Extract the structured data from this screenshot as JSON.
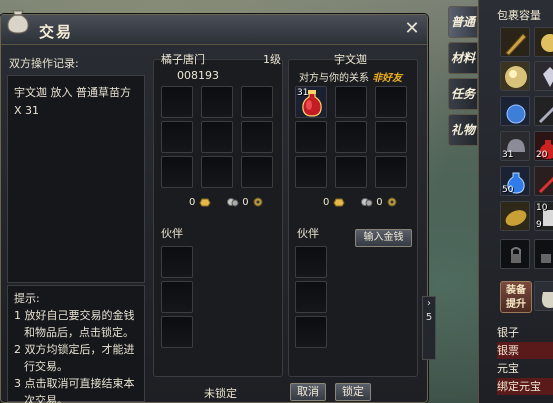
{
  "window": {
    "title": "交易",
    "close": "✕"
  },
  "log": {
    "label": "双方操作记录:",
    "entry": "宇文迦 放入 普通草苗方 X 31"
  },
  "tips": {
    "header": "提示:",
    "lines": [
      "1 放好自己要交易的金钱",
      "和物品后，点击锁定。",
      "2 双方均锁定后，才能进",
      "行交易。",
      "3 点击取消可直接结束本",
      "次交易。"
    ]
  },
  "self": {
    "name": "橘子唐门",
    "level": "1级",
    "id": "008193",
    "money_gold": "0",
    "money_silver": "0",
    "partner_label": "伙伴"
  },
  "other": {
    "name": "宇文迦",
    "relation_label": "对方与你的关系",
    "relation_value": "非好友",
    "item_count": "31",
    "money_gold": "0",
    "money_silver": "0",
    "partner_label": "伙伴"
  },
  "buttons": {
    "enter_money": "输入金钱",
    "lock_status": "未锁定",
    "cancel": "取消",
    "confirm": "锁定"
  },
  "tabs": [
    {
      "label": "普通",
      "active": true
    },
    {
      "label": "材料",
      "active": false
    },
    {
      "label": "任务",
      "active": false
    },
    {
      "label": "礼物",
      "active": false
    }
  ],
  "inventory": {
    "title": "包裹容量",
    "counts": {
      "slot_row4_a": "31",
      "slot_row4_b": "20",
      "slot_row5_a": "50",
      "slot_row6_b": "9",
      "slot_row5_b": "10"
    },
    "equip_button": "装备\n提升",
    "equip_line1": "装备",
    "equip_line2": "提升",
    "currencies": [
      "银子",
      "银票",
      "元宝",
      "绑定元宝"
    ]
  },
  "misc": {
    "scroll_digit": "5"
  }
}
